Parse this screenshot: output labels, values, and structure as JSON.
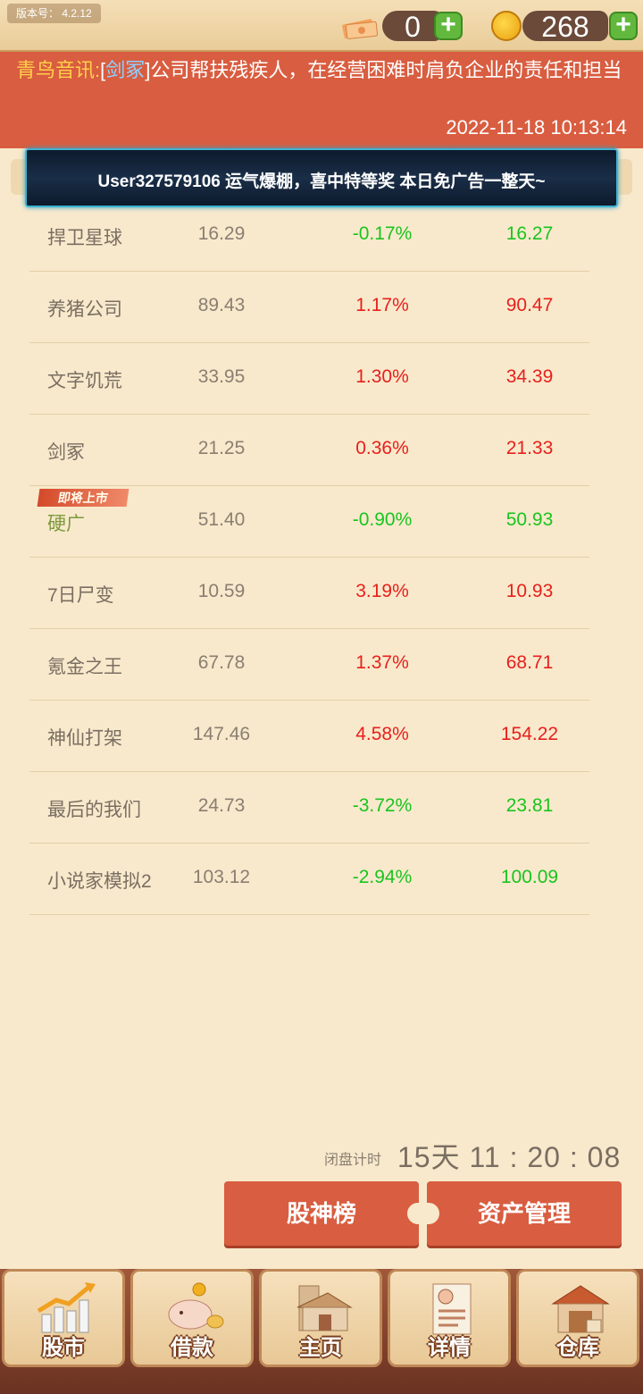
{
  "header": {
    "version_label": "版本号： 4.2.12",
    "cash_amount": "0",
    "coin_amount": "268"
  },
  "news": {
    "source": "青鸟音讯:",
    "tag_open": "[",
    "tag": "剑冢",
    "tag_close": "]",
    "text": "公司帮扶残疾人，在经营困难时肩负企业的责任和担当",
    "time": "2022-11-18 10:13:14"
  },
  "banner": {
    "text": "User327579106 运气爆棚，喜中特等奖 本日免广告一整天~"
  },
  "stocks": [
    {
      "name": "捍卫星球",
      "price": "16.29",
      "change": "-0.17%",
      "next": "16.27",
      "trend": "down"
    },
    {
      "name": "养猪公司",
      "price": "89.43",
      "change": "1.17%",
      "next": "90.47",
      "trend": "up"
    },
    {
      "name": "文字饥荒",
      "price": "33.95",
      "change": "1.30%",
      "next": "34.39",
      "trend": "up"
    },
    {
      "name": "剑冢",
      "price": "21.25",
      "change": "0.36%",
      "next": "21.33",
      "trend": "up"
    },
    {
      "name": "硬广",
      "price": "51.40",
      "change": "-0.90%",
      "next": "50.93",
      "trend": "down",
      "badge": "即将上市"
    },
    {
      "name": "7日尸变",
      "price": "10.59",
      "change": "3.19%",
      "next": "10.93",
      "trend": "up"
    },
    {
      "name": "氪金之王",
      "price": "67.78",
      "change": "1.37%",
      "next": "68.71",
      "trend": "up"
    },
    {
      "name": "神仙打架",
      "price": "147.46",
      "change": "4.58%",
      "next": "154.22",
      "trend": "up"
    },
    {
      "name": "最后的我们",
      "price": "24.73",
      "change": "-3.72%",
      "next": "23.81",
      "trend": "down"
    },
    {
      "name": "小说家模拟2",
      "price": "103.12",
      "change": "-2.94%",
      "next": "100.09",
      "trend": "down"
    }
  ],
  "countdown": {
    "label": "闭盘计时",
    "value": "15天 11 : 20 : 08"
  },
  "actions": {
    "leaderboard": "股神榜",
    "assets": "资产管理"
  },
  "nav": {
    "tabs": [
      {
        "label": "股市",
        "icon": "chart-icon"
      },
      {
        "label": "借款",
        "icon": "piggy-bank-icon"
      },
      {
        "label": "主页",
        "icon": "house-icon"
      },
      {
        "label": "详情",
        "icon": "profile-card-icon"
      },
      {
        "label": "仓库",
        "icon": "warehouse-icon"
      }
    ]
  },
  "colors": {
    "up": "#e8201c",
    "down": "#19c41e",
    "accent": "#d95d40",
    "background": "#f8e9cc"
  }
}
